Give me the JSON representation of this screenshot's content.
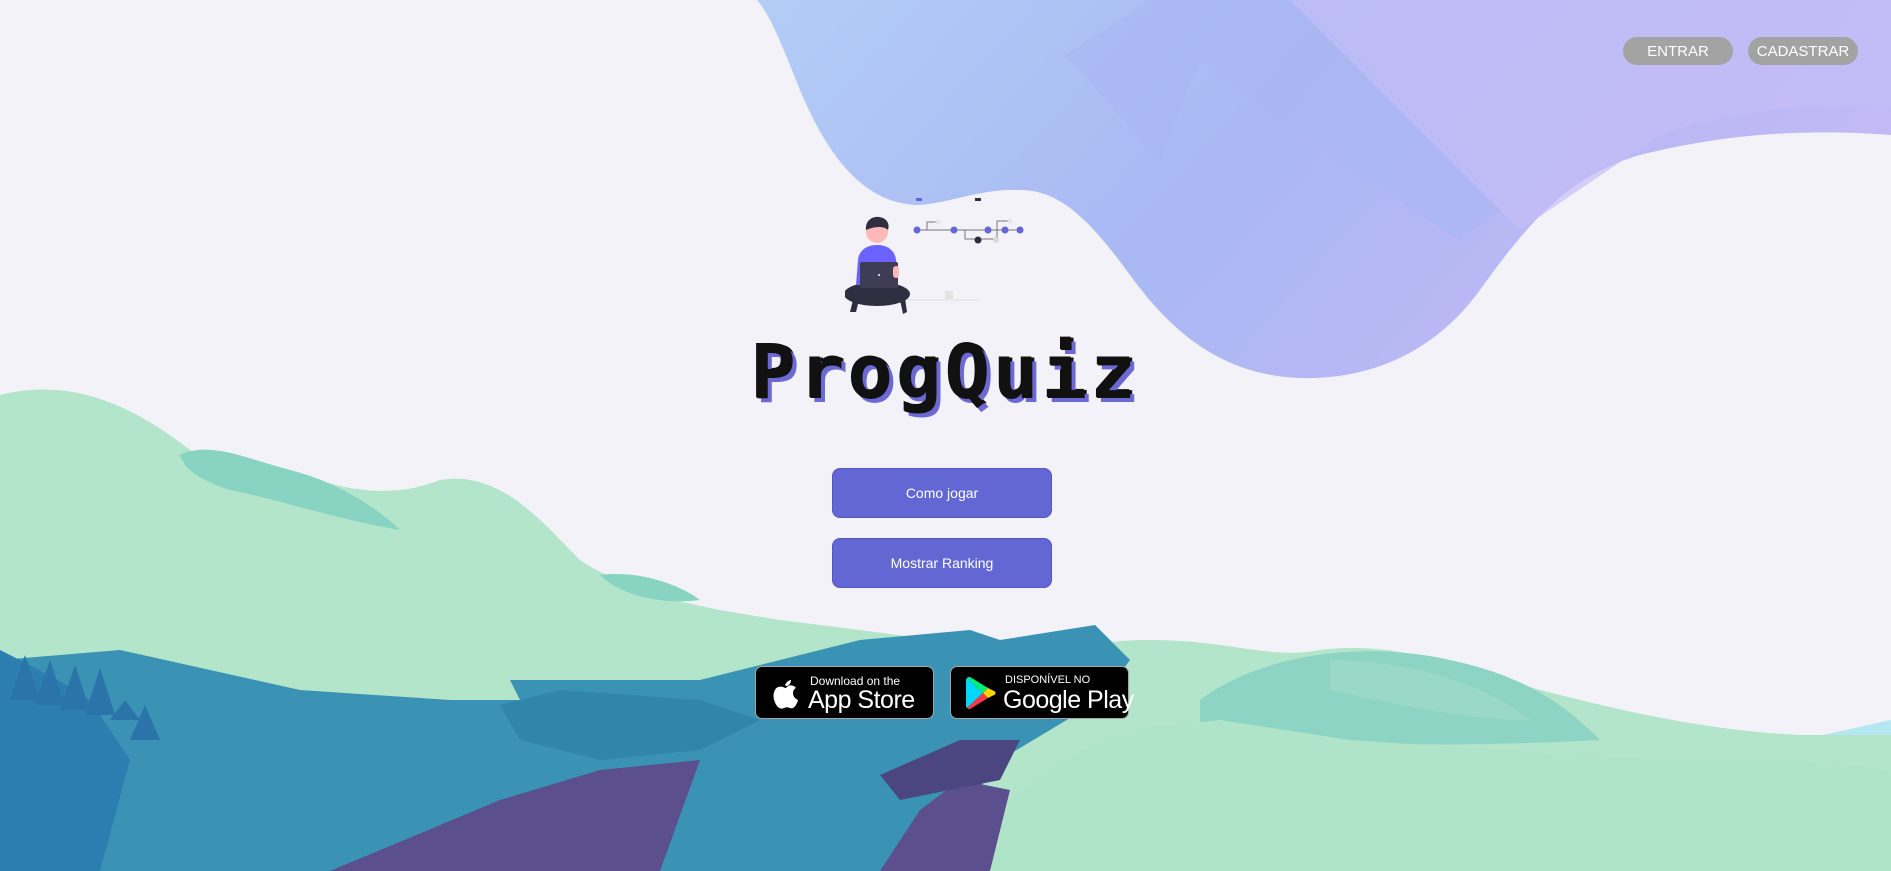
{
  "header": {
    "login_label": "ENTRAR",
    "signup_label": "CADASTRAR"
  },
  "logo": {
    "text": "ProgQuiz"
  },
  "menu": {
    "how_to_play_label": "Como jogar",
    "ranking_label": "Mostrar Ranking"
  },
  "badges": {
    "appstore": {
      "small": "Download on the",
      "big": "App Store",
      "icon": "apple-icon"
    },
    "googleplay": {
      "small": "DISPONÍVEL NO",
      "big": "Google Play",
      "icon": "google-play-icon"
    }
  },
  "colors": {
    "accent": "#6267d3",
    "top_button": "#a3a3a3",
    "background": "#f3f2f8"
  }
}
